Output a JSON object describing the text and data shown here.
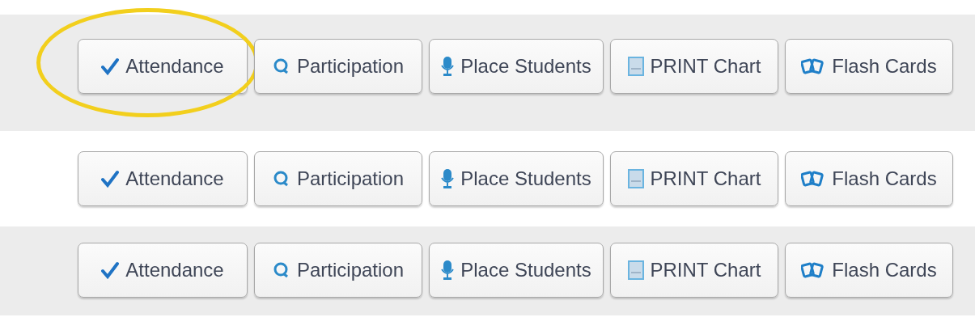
{
  "toolbars": [
    {
      "shaded": true,
      "buttons": [
        {
          "kind": "check",
          "label": "Attendance",
          "circled": true
        },
        {
          "kind": "bubble",
          "label": "Participation",
          "circled": false
        },
        {
          "kind": "mic",
          "label": "Place Students",
          "circled": false
        },
        {
          "kind": "sheet",
          "label": "PRINT Chart",
          "circled": false
        },
        {
          "kind": "cards",
          "label": "Flash Cards",
          "circled": false
        }
      ]
    },
    {
      "shaded": false,
      "buttons": [
        {
          "kind": "check",
          "label": "Attendance",
          "circled": false
        },
        {
          "kind": "bubble",
          "label": "Participation",
          "circled": false
        },
        {
          "kind": "mic",
          "label": "Place Students",
          "circled": false
        },
        {
          "kind": "sheet",
          "label": "PRINT Chart",
          "circled": false
        },
        {
          "kind": "cards",
          "label": "Flash Cards",
          "circled": false
        }
      ]
    },
    {
      "shaded": true,
      "buttons": [
        {
          "kind": "check",
          "label": "Attendance",
          "circled": false
        },
        {
          "kind": "bubble",
          "label": "Participation",
          "circled": false
        },
        {
          "kind": "mic",
          "label": "Place Students",
          "circled": false
        },
        {
          "kind": "sheet",
          "label": "PRINT Chart",
          "circled": false
        },
        {
          "kind": "cards",
          "label": "Flash Cards",
          "circled": false
        }
      ]
    }
  ]
}
